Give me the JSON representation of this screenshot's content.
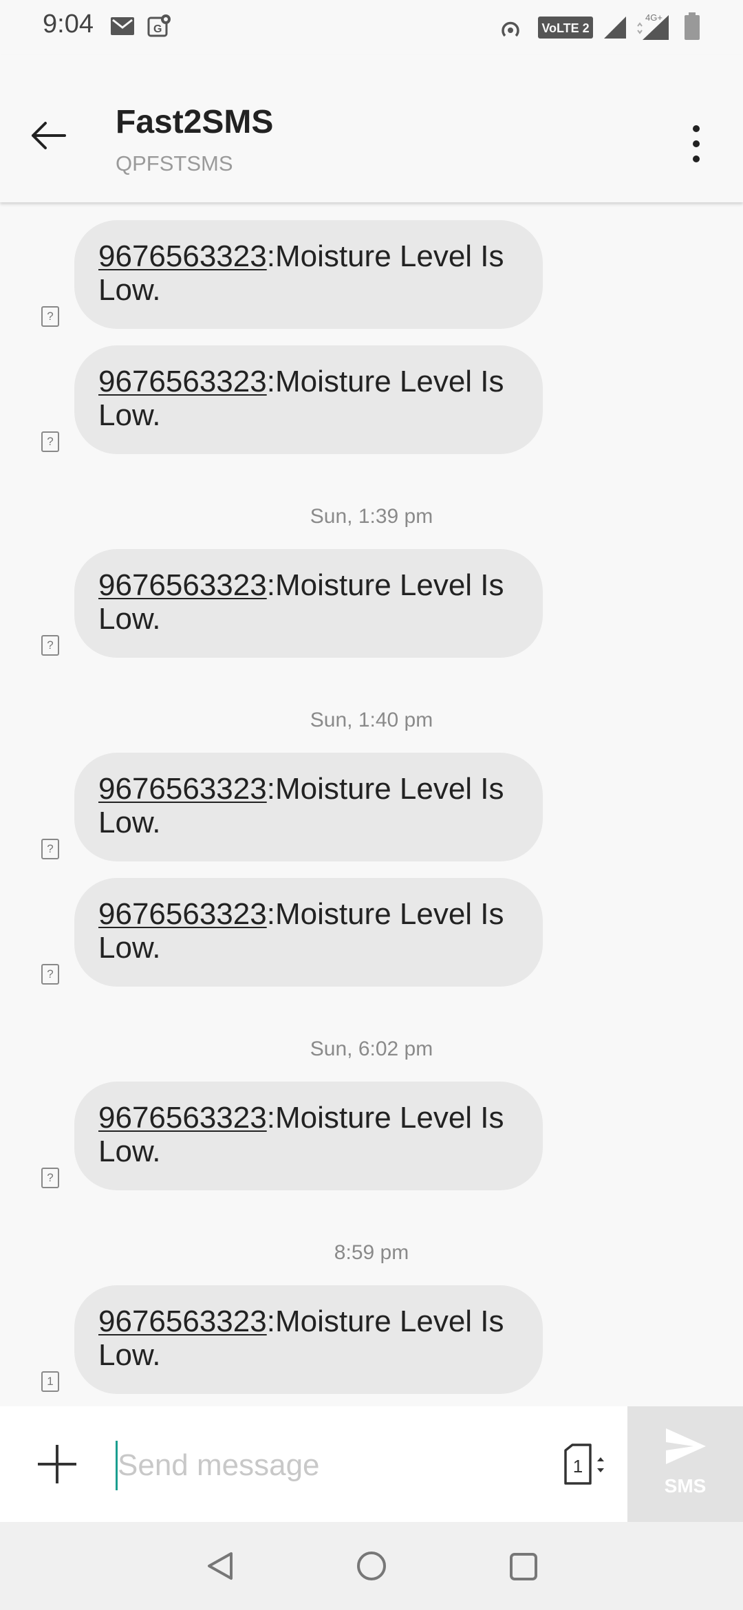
{
  "status_bar": {
    "time": "9:04",
    "icons": [
      "gmail-icon",
      "maps-notification-icon",
      "hotspot-icon",
      "volte-icon",
      "signal-icon",
      "signal-4g-icon",
      "battery-icon"
    ],
    "volte_label": "VoLTE 2",
    "network_label": "4G+"
  },
  "header": {
    "title": "Fast2SMS",
    "subtitle": "QPFSTSMS"
  },
  "messages": [
    {
      "number": "9676563323",
      "text": ":Moisture Level Is Low.",
      "sim": "?"
    },
    {
      "number": "9676563323",
      "text": ":Moisture Level Is Low.",
      "sim": "?"
    },
    {
      "timestamp": "Sun, 1:39 pm"
    },
    {
      "number": "9676563323",
      "text": ":Moisture Level Is Low.",
      "sim": "?"
    },
    {
      "timestamp": "Sun, 1:40 pm"
    },
    {
      "number": "9676563323",
      "text": ":Moisture Level Is Low.",
      "sim": "?"
    },
    {
      "number": "9676563323",
      "text": ":Moisture Level Is Low.",
      "sim": "?"
    },
    {
      "timestamp": "Sun, 6:02 pm"
    },
    {
      "number": "9676563323",
      "text": ":Moisture Level Is Low.",
      "sim": "?"
    },
    {
      "timestamp": "8:59 pm"
    },
    {
      "number": "9676563323",
      "text": ":Moisture Level Is Low.",
      "sim": "1"
    }
  ],
  "compose": {
    "placeholder": "Send message",
    "value": "",
    "sim_slot": "1",
    "send_label": "SMS"
  },
  "colors": {
    "background": "#f8f8f8",
    "bubble": "#e8e8e8",
    "cursor_accent": "#1a9e8f",
    "send_disabled": "#e2e2e2"
  }
}
